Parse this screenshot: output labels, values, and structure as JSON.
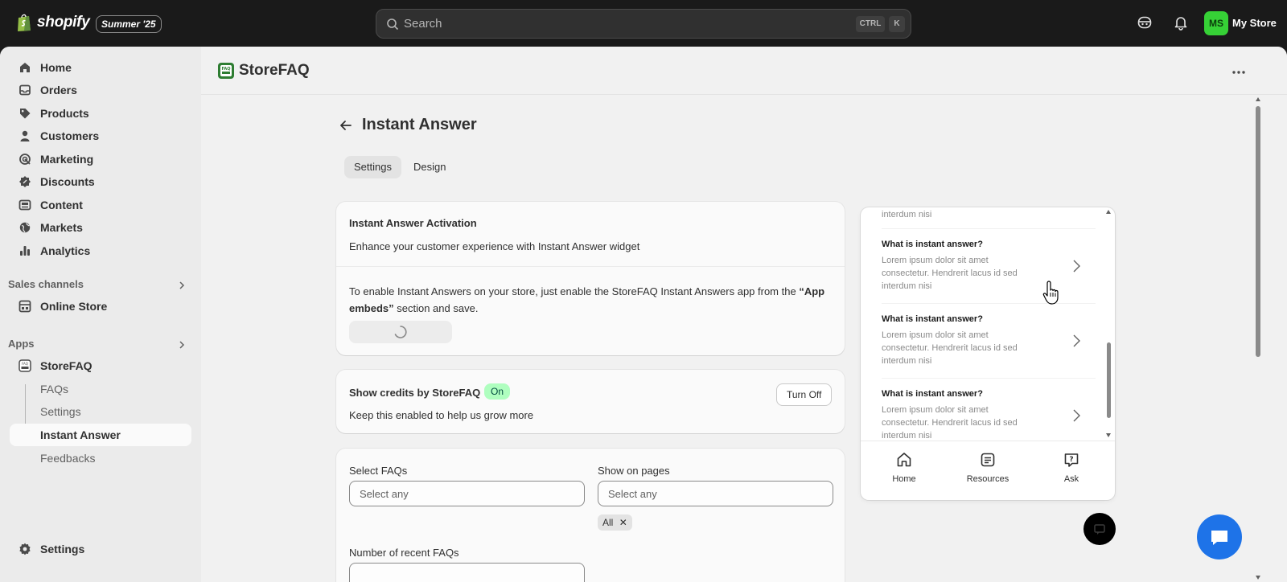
{
  "topbar": {
    "brand": "shopify",
    "edition": "Summer '25",
    "search_placeholder": "Search",
    "shortcut_ctrl": "CTRL",
    "shortcut_k": "K",
    "avatar_initials": "MS",
    "store_name": "My Store"
  },
  "sidebar": {
    "items": [
      {
        "label": "Home",
        "icon": "home-icon"
      },
      {
        "label": "Orders",
        "icon": "inbox-icon"
      },
      {
        "label": "Products",
        "icon": "tag-icon"
      },
      {
        "label": "Customers",
        "icon": "person-icon"
      },
      {
        "label": "Marketing",
        "icon": "target-icon"
      },
      {
        "label": "Discounts",
        "icon": "discount-icon"
      },
      {
        "label": "Content",
        "icon": "image-icon"
      },
      {
        "label": "Markets",
        "icon": "globe-icon"
      },
      {
        "label": "Analytics",
        "icon": "bar-chart-icon"
      }
    ],
    "sales_channels_label": "Sales channels",
    "online_store": "Online Store",
    "apps_label": "Apps",
    "app_name": "StoreFAQ",
    "app_subitems": [
      "FAQs",
      "Settings",
      "Instant Answer",
      "Feedbacks"
    ],
    "settings": "Settings"
  },
  "app": {
    "title": "StoreFAQ",
    "logo_text": "FAQ"
  },
  "page": {
    "title": "Instant Answer",
    "tabs": [
      "Settings",
      "Design"
    ],
    "activation": {
      "title": "Instant Answer Activation",
      "subtitle": "Enhance your customer experience with Instant Answer widget",
      "instruction_1": "To enable Instant Answers on your store, just enable the StoreFAQ Instant Answers app from the ",
      "instruction_bold": "“App embeds”",
      "instruction_2": " section and save."
    },
    "credits": {
      "title": "Show credits by StoreFAQ",
      "status": "On",
      "description": "Keep this enabled to help us grow more",
      "button": "Turn Off"
    },
    "form": {
      "select_faqs_label": "Select FAQs",
      "select_faqs_placeholder": "Select any",
      "show_pages_label": "Show on pages",
      "show_pages_placeholder": "Select any",
      "pages_chip": "All",
      "recent_label": "Number of recent FAQs"
    }
  },
  "preview": {
    "top_partial": "interdum nisi",
    "faqs": [
      {
        "question": "What is instant answer?",
        "answer": "Lorem ipsum dolor sit amet consectetur. Hendrerit lacus id sed interdum nisi"
      },
      {
        "question": "What is instant answer?",
        "answer": "Lorem ipsum dolor sit amet consectetur. Hendrerit lacus id sed interdum nisi"
      },
      {
        "question": "What is instant answer?",
        "answer": "Lorem ipsum dolor sit amet consectetur. Hendrerit lacus id sed interdum nisi"
      }
    ],
    "footer_tabs": [
      "Home",
      "Resources",
      "Ask"
    ]
  },
  "colors": {
    "topbar": "#1a1a1a",
    "avatar": "#36d136",
    "badge_on": "#affebf",
    "chat_bubble": "#1e73e8"
  }
}
